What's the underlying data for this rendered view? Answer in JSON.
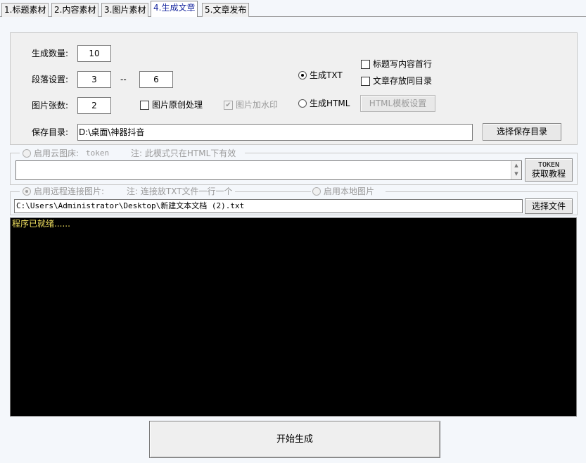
{
  "tabs": [
    {
      "label": "1.标题素材"
    },
    {
      "label": "2.内容素材"
    },
    {
      "label": "3.图片素材"
    },
    {
      "label": "4.生成文章"
    },
    {
      "label": "5.文章发布"
    }
  ],
  "settings": {
    "count_label": "生成数量:",
    "count_value": "10",
    "paragraph_label": "段落设置:",
    "paragraph_min": "3",
    "paragraph_sep": "--",
    "paragraph_max": "6",
    "images_label": "图片张数:",
    "images_value": "2",
    "original_image_label": "图片原创处理",
    "original_image_checked": false,
    "watermark_label": "图片加水印",
    "watermark_checked": true,
    "gen_txt_label": "生成TXT",
    "gen_html_label": "生成HTML",
    "output_format": "txt",
    "title_first_line_label": "标题写内容首行",
    "title_first_line_checked": false,
    "same_dir_label": "文章存放同目录",
    "same_dir_checked": false,
    "html_template_button": "HTML模板设置",
    "save_dir_label": "保存目录:",
    "save_dir_value": "D:\\桌面\\神器抖音",
    "choose_save_dir_button": "选择保存目录"
  },
  "cloud": {
    "radio_label": "启用云图床:",
    "token_label": "token",
    "note": "注: 此模式只在HTML下有效",
    "token_value": "",
    "token_button_line1": "TOKEN",
    "token_button_line2": "获取教程"
  },
  "remote": {
    "remote_label": "启用远程连接图片:",
    "remote_note": "注: 连接放TXT文件一行一个",
    "local_label": "启用本地图片",
    "file_path": "C:\\Users\\Administrator\\Desktop\\新建文本文档 (2).txt",
    "choose_file_button": "选择文件"
  },
  "console": {
    "status_text": "程序已就绪......",
    "text_color": "#f0e060"
  },
  "start_button": "开始生成"
}
